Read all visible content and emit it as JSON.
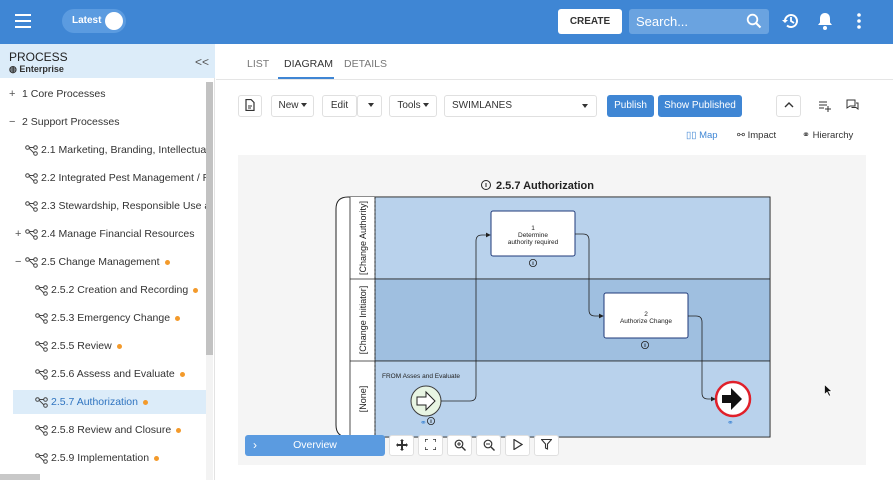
{
  "header": {
    "menu_icon": "hamburger-menu-icon",
    "version_toggle_label": "Latest",
    "create_label": "CREATE",
    "search_placeholder": "Search...",
    "accent": "#3f86d4"
  },
  "sidebar": {
    "title": "PROCESS",
    "subtitle": "Enterprise",
    "tree": [
      {
        "label": "1 Core Processes",
        "toggle": "+",
        "icon": "",
        "dot": false,
        "selected": false
      },
      {
        "label": "2 Support Processes",
        "toggle": "−",
        "icon": "",
        "dot": false,
        "selected": false
      },
      {
        "label": "2.1 Marketing, Branding, Intellectual",
        "toggle": "",
        "icon": "process-icon",
        "dot": false,
        "selected": false
      },
      {
        "label": "2.2 Integrated Pest Management / R",
        "toggle": "",
        "icon": "process-icon",
        "dot": false,
        "selected": false
      },
      {
        "label": "2.3 Stewardship, Responsible Use a",
        "toggle": "",
        "icon": "process-icon",
        "dot": false,
        "selected": false
      },
      {
        "label": "2.4 Manage Financial Resources",
        "toggle": "+",
        "icon": "process-icon",
        "dot": false,
        "selected": false
      },
      {
        "label": "2.5 Change Management",
        "toggle": "−",
        "icon": "process-icon",
        "dot": true,
        "selected": false
      },
      {
        "label": "2.5.2 Creation and Recording",
        "toggle": "",
        "icon": "process-icon",
        "dot": true,
        "selected": false
      },
      {
        "label": "2.5.3 Emergency Change",
        "toggle": "",
        "icon": "process-icon",
        "dot": true,
        "selected": false
      },
      {
        "label": "2.5.5 Review",
        "toggle": "",
        "icon": "process-icon",
        "dot": true,
        "selected": false
      },
      {
        "label": "2.5.6 Assess and Evaluate",
        "toggle": "",
        "icon": "process-icon",
        "dot": true,
        "selected": false
      },
      {
        "label": "2.5.7 Authorization",
        "toggle": "",
        "icon": "process-icon",
        "dot": true,
        "selected": true
      },
      {
        "label": "2.5.8 Review and Closure",
        "toggle": "",
        "icon": "process-icon",
        "dot": true,
        "selected": false
      },
      {
        "label": "2.5.9 Implementation",
        "toggle": "",
        "icon": "process-icon",
        "dot": true,
        "selected": false
      }
    ]
  },
  "tabs": [
    {
      "label": "LIST",
      "active": false
    },
    {
      "label": "DIAGRAM",
      "active": true
    },
    {
      "label": "DETAILS",
      "active": false
    }
  ],
  "toolbar": {
    "new_label": "New",
    "edit_label": "Edit",
    "tools_label": "Tools",
    "view_select": "SWIMLANES",
    "publish_label": "Publish",
    "show_published_label": "Show Published"
  },
  "views": {
    "map": "Map",
    "impact": "Impact",
    "hierarchy": "Hierarchy"
  },
  "diagram": {
    "title": "2.5.7 Authorization",
    "lanes": [
      "[Change Authority]",
      "[Change Initiator]",
      "[None]"
    ],
    "lane_colors": [
      "#b9d2ec",
      "#9fbfe0",
      "#b9d2ec"
    ],
    "task1": [
      "1",
      "Determine",
      "authority required"
    ],
    "task2": [
      "2",
      "Authorize Change"
    ],
    "start_label": "FROM Asses and Evaluate"
  },
  "overview": {
    "label": "Overview"
  }
}
